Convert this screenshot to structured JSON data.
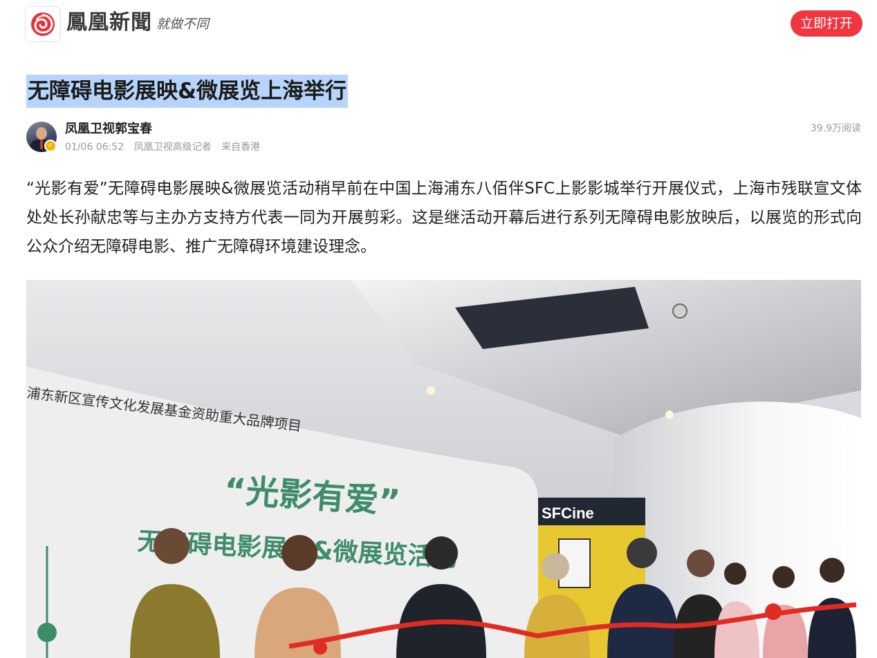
{
  "header": {
    "brand_name": "鳳凰新聞",
    "slogan": "就做不同",
    "open_button_label": "立即打开",
    "logo_icon": "phoenix-logo-icon",
    "accent_color": "#f0363f"
  },
  "article": {
    "title": "无障碍电影展映&微展览上海举行",
    "author": {
      "name": "凤凰卫视郭宝春",
      "date": "01/06 06:52",
      "role": "凤凰卫视高级记者",
      "location": "来自香港",
      "verified_icon": "verified-badge-icon"
    },
    "read_count": "39.9万阅读",
    "paragraph": "“光影有爱”无障碍电影展映&微展览活动稍早前在中国上海浦东八佰伴SFC上影影城举行开展仪式，上海市残联宣文体处处长孙献忠等与主办方支持方代表一同为开展剪彩。这是继活动开幕后进行系列无障碍电影放映后，以展览的形式向公众介绍无障碍电影、推广无障碍环境建设理念。",
    "photo": {
      "banner_text_1": "浦东新区宣传文化发展基金资助重大品牌项目",
      "banner_text_2": "“光影有爱”",
      "banner_text_3": "无障碍电影展映&微展览活动",
      "sign_text": "SFCine"
    }
  }
}
